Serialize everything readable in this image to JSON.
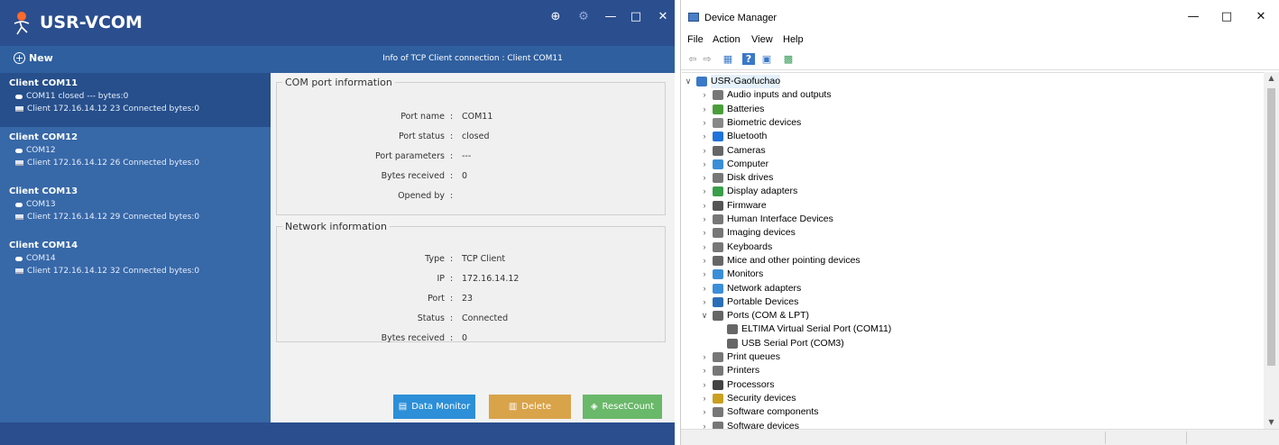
{
  "vcom": {
    "app_title": "USR-VCOM",
    "new_label": "New",
    "conn_info": "Info of TCP Client connection : Client COM11",
    "connections": [
      {
        "title": "Client COM11",
        "port_line": "COM11 closed --- bytes:0",
        "net_line": "Client 172.16.14.12 23 Connected bytes:0"
      },
      {
        "title": "Client COM12",
        "port_line": "COM12",
        "net_line": "Client 172.16.14.12 26 Connected bytes:0"
      },
      {
        "title": "Client COM13",
        "port_line": "COM13",
        "net_line": "Client 172.16.14.12 29 Connected bytes:0"
      },
      {
        "title": "Client COM14",
        "port_line": "COM14",
        "net_line": "Client 172.16.14.12 32 Connected bytes:0"
      }
    ],
    "com_section": {
      "legend": "COM port information",
      "rows": [
        {
          "k": "Port name",
          "v": "COM11"
        },
        {
          "k": "Port status",
          "v": "closed"
        },
        {
          "k": "Port parameters",
          "v": "---"
        },
        {
          "k": "Bytes received",
          "v": "0"
        },
        {
          "k": "Opened by",
          "v": ""
        }
      ]
    },
    "net_section": {
      "legend": "Network information",
      "rows": [
        {
          "k": "Type",
          "v": "TCP Client"
        },
        {
          "k": "IP",
          "v": "172.16.14.12"
        },
        {
          "k": "Port",
          "v": "23"
        },
        {
          "k": "Status",
          "v": "Connected"
        },
        {
          "k": "Bytes received",
          "v": "0"
        }
      ]
    },
    "buttons": {
      "data_monitor": "Data Monitor",
      "delete": "Delete",
      "reset": "ResetCount"
    },
    "colors": {
      "title_bg": "#2b4e8e",
      "list_bg": "#3768a8",
      "selected_bg": "#264f8b",
      "btn_blue": "#2c8fd8",
      "btn_orange": "#d9a34a",
      "btn_green": "#6ab86a"
    }
  },
  "devmgr": {
    "title": "Device Manager",
    "menu": [
      "File",
      "Action",
      "View",
      "Help"
    ],
    "root": "USR-Gaofuchao",
    "items": [
      {
        "label": "Audio inputs and outputs",
        "icon": "speaker-icon",
        "color": "#777"
      },
      {
        "label": "Batteries",
        "icon": "battery-icon",
        "color": "#4a9e3a"
      },
      {
        "label": "Biometric devices",
        "icon": "fingerprint-icon",
        "color": "#888"
      },
      {
        "label": "Bluetooth",
        "icon": "bluetooth-icon",
        "color": "#1e73d8"
      },
      {
        "label": "Cameras",
        "icon": "camera-icon",
        "color": "#666"
      },
      {
        "label": "Computer",
        "icon": "computer-icon",
        "color": "#3a8ed8"
      },
      {
        "label": "Disk drives",
        "icon": "disk-icon",
        "color": "#777"
      },
      {
        "label": "Display adapters",
        "icon": "display-adapter-icon",
        "color": "#3a9e4a"
      },
      {
        "label": "Firmware",
        "icon": "firmware-icon",
        "color": "#555"
      },
      {
        "label": "Human Interface Devices",
        "icon": "hid-icon",
        "color": "#777"
      },
      {
        "label": "Imaging devices",
        "icon": "scanner-icon",
        "color": "#777"
      },
      {
        "label": "Keyboards",
        "icon": "keyboard-icon",
        "color": "#777"
      },
      {
        "label": "Mice and other pointing devices",
        "icon": "mouse-icon",
        "color": "#666"
      },
      {
        "label": "Monitors",
        "icon": "monitor-icon",
        "color": "#3a8ed8"
      },
      {
        "label": "Network adapters",
        "icon": "network-icon",
        "color": "#3a8ed8"
      },
      {
        "label": "Portable Devices",
        "icon": "portable-device-icon",
        "color": "#2a6eb8"
      },
      {
        "label": "Ports (COM & LPT)",
        "icon": "port-icon",
        "color": "#666",
        "expanded": true,
        "children": [
          {
            "label": "ELTIMA Virtual Serial Port (COM11)",
            "icon": "port-icon"
          },
          {
            "label": "USB Serial Port (COM3)",
            "icon": "port-icon"
          }
        ]
      },
      {
        "label": "Print queues",
        "icon": "print-queue-icon",
        "color": "#777"
      },
      {
        "label": "Printers",
        "icon": "printer-icon",
        "color": "#777"
      },
      {
        "label": "Processors",
        "icon": "processor-icon",
        "color": "#444"
      },
      {
        "label": "Security devices",
        "icon": "security-icon",
        "color": "#c9a020"
      },
      {
        "label": "Software components",
        "icon": "software-component-icon",
        "color": "#777"
      },
      {
        "label": "Software devices",
        "icon": "software-device-icon",
        "color": "#777"
      }
    ]
  }
}
